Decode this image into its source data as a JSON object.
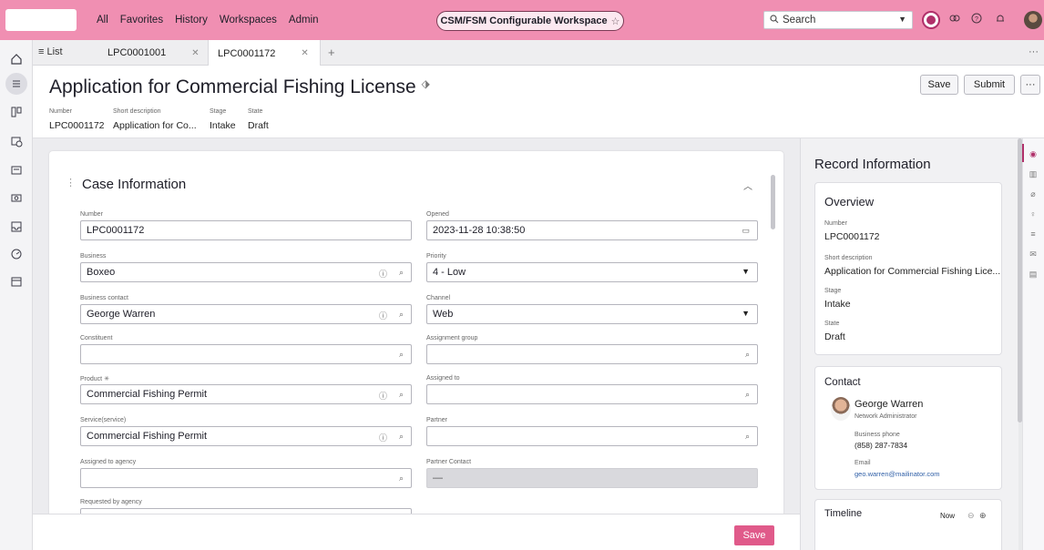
{
  "topnav": {
    "items": [
      "All",
      "Favorites",
      "History",
      "Workspaces",
      "Admin"
    ],
    "workspace_pill": "CSM/FSM Configurable Workspace",
    "search_placeholder": "Search"
  },
  "tabs": {
    "list_label": "≡ List",
    "items": [
      {
        "label": "LPC0001001"
      },
      {
        "label": "LPC0001172"
      }
    ]
  },
  "header": {
    "title": "Application for Commercial Fishing License",
    "save_label": "Save",
    "submit_label": "Submit",
    "more_label": "···",
    "meta": [
      {
        "label": "Number",
        "value": "LPC0001172"
      },
      {
        "label": "Short description",
        "value": "Application for Co..."
      },
      {
        "label": "Stage",
        "value": "Intake"
      },
      {
        "label": "State",
        "value": "Draft"
      }
    ]
  },
  "form": {
    "section_title": "Case Information",
    "left": [
      {
        "label": "Number",
        "value": ""
      },
      {
        "label": "Business",
        "value": "Boxeo"
      },
      {
        "label": "Business contact",
        "value": "George Warren"
      },
      {
        "label": "Constituent",
        "value": ""
      },
      {
        "label": "Product ✳",
        "value": "Commercial Fishing Permit"
      },
      {
        "label": "Service(service)",
        "value": "Commercial Fishing Permit"
      },
      {
        "label": "Assigned to agency",
        "value": ""
      },
      {
        "label": "Requested by agency",
        "value": ""
      }
    ],
    "number_value": "LPC0001172",
    "right": [
      {
        "label": "Opened",
        "value": "2023-11-28 10:38:50"
      },
      {
        "label": "Priority",
        "value": "4 - Low"
      },
      {
        "label": "Channel",
        "value": "Web"
      },
      {
        "label": "Assignment group",
        "value": ""
      },
      {
        "label": "Assigned to",
        "value": ""
      },
      {
        "label": "Partner",
        "value": ""
      },
      {
        "label": "Partner Contact",
        "value": "—"
      }
    ],
    "save_label": "Save"
  },
  "record_info": {
    "title": "Record Information",
    "overview": {
      "title": "Overview",
      "fields": [
        {
          "label": "Number",
          "value": "LPC0001172"
        },
        {
          "label": "Short description",
          "value": "Application for Commercial Fishing Lice..."
        },
        {
          "label": "Stage",
          "value": "Intake"
        },
        {
          "label": "State",
          "value": "Draft"
        }
      ]
    },
    "contact": {
      "title": "Contact",
      "name": "George Warren",
      "role": "Network Administrator",
      "phone_label": "Business phone",
      "phone": "(858) 287-7834",
      "email_label": "Email",
      "email": "geo.warren@mailinator.com"
    },
    "timeline": {
      "title": "Timeline",
      "now_label": "Now"
    }
  },
  "colors": {
    "topbar": "#f08fb2",
    "accent": "#b0306a",
    "save_button": "#e05a8a"
  }
}
